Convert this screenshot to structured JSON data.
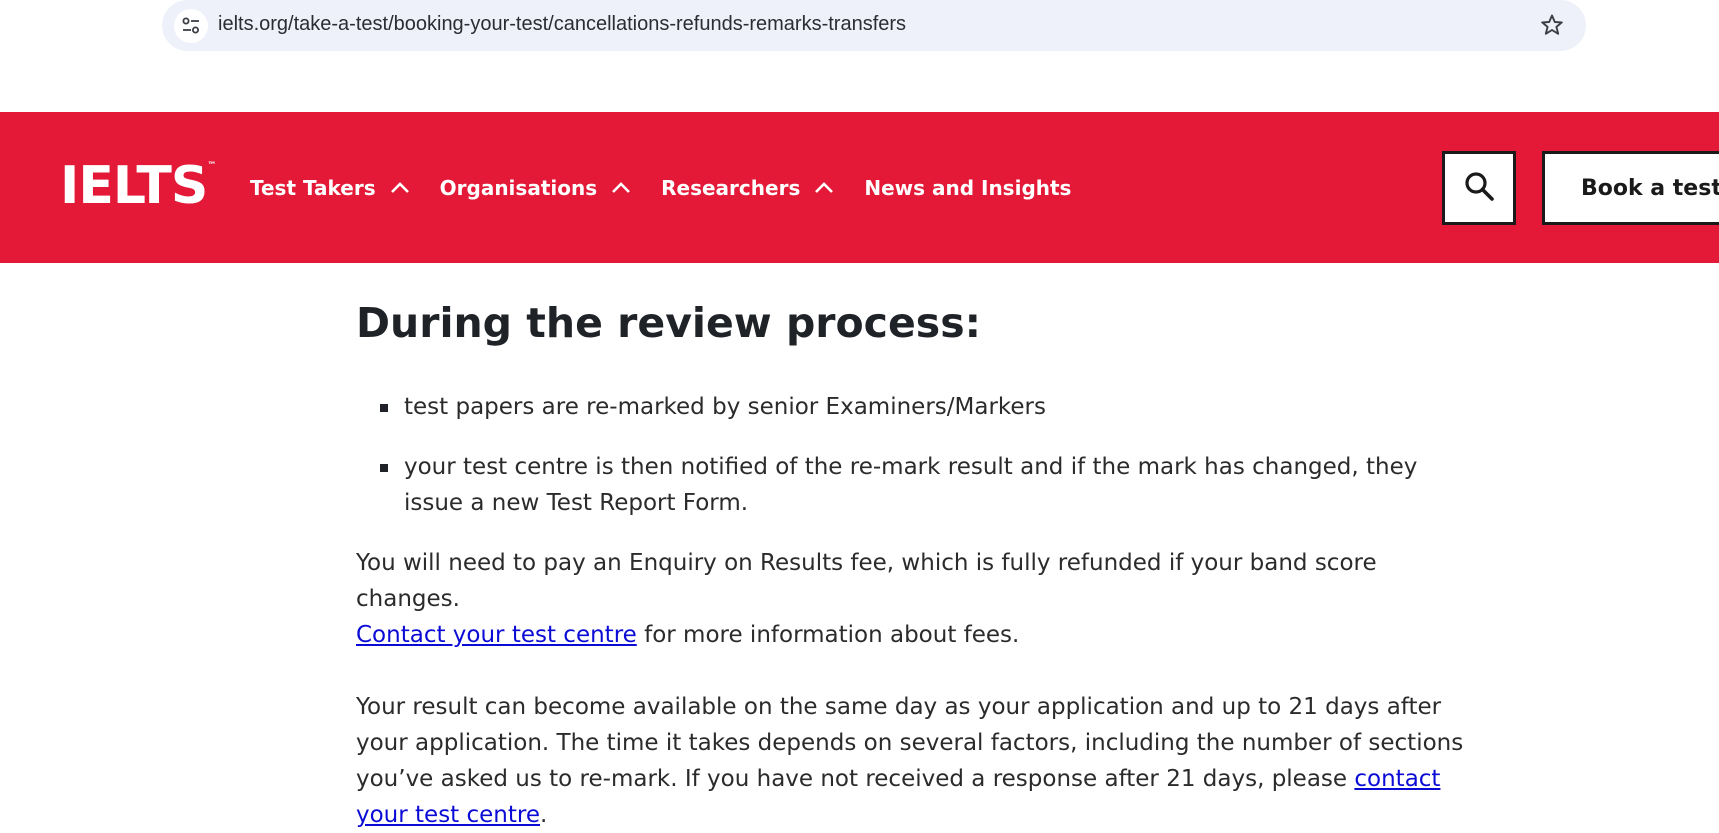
{
  "browser": {
    "url": "ielts.org/take-a-test/booking-your-test/cancellations-refunds-remarks-transfers",
    "icons": {
      "site_info": "tune-icon",
      "bookmark": "star-icon"
    }
  },
  "header": {
    "logo_text": "IELTS",
    "logo_tm": "™",
    "brand_color": "#e31937",
    "nav": [
      {
        "label": "Test Takers",
        "has_chevron": true
      },
      {
        "label": "Organisations",
        "has_chevron": true
      },
      {
        "label": "Researchers",
        "has_chevron": true
      },
      {
        "label": "News and Insights",
        "has_chevron": false
      }
    ],
    "search_icon": "search-icon",
    "book_label": "Book a test"
  },
  "content": {
    "heading": "During the review process:",
    "bullets": [
      "test papers are re-marked by senior Examiners/Markers",
      "your test centre is then notified of the re-mark result and if the mark has changed, they issue a new Test Report Form."
    ],
    "para1": {
      "text": "You will need to pay an Enquiry on Results fee, which is fully refunded if your band score changes.",
      "link": "Contact your test centre",
      "after_link": " for more information about fees."
    },
    "para2": {
      "text": "Your result can become available on the same day as your application and up to 21 days after your application. The time it takes depends on several factors, including the number of sections you’ve asked us to re-mark. If you have not received a response after 21 days, please ",
      "link": "contact your test centre",
      "after_link": "."
    }
  }
}
